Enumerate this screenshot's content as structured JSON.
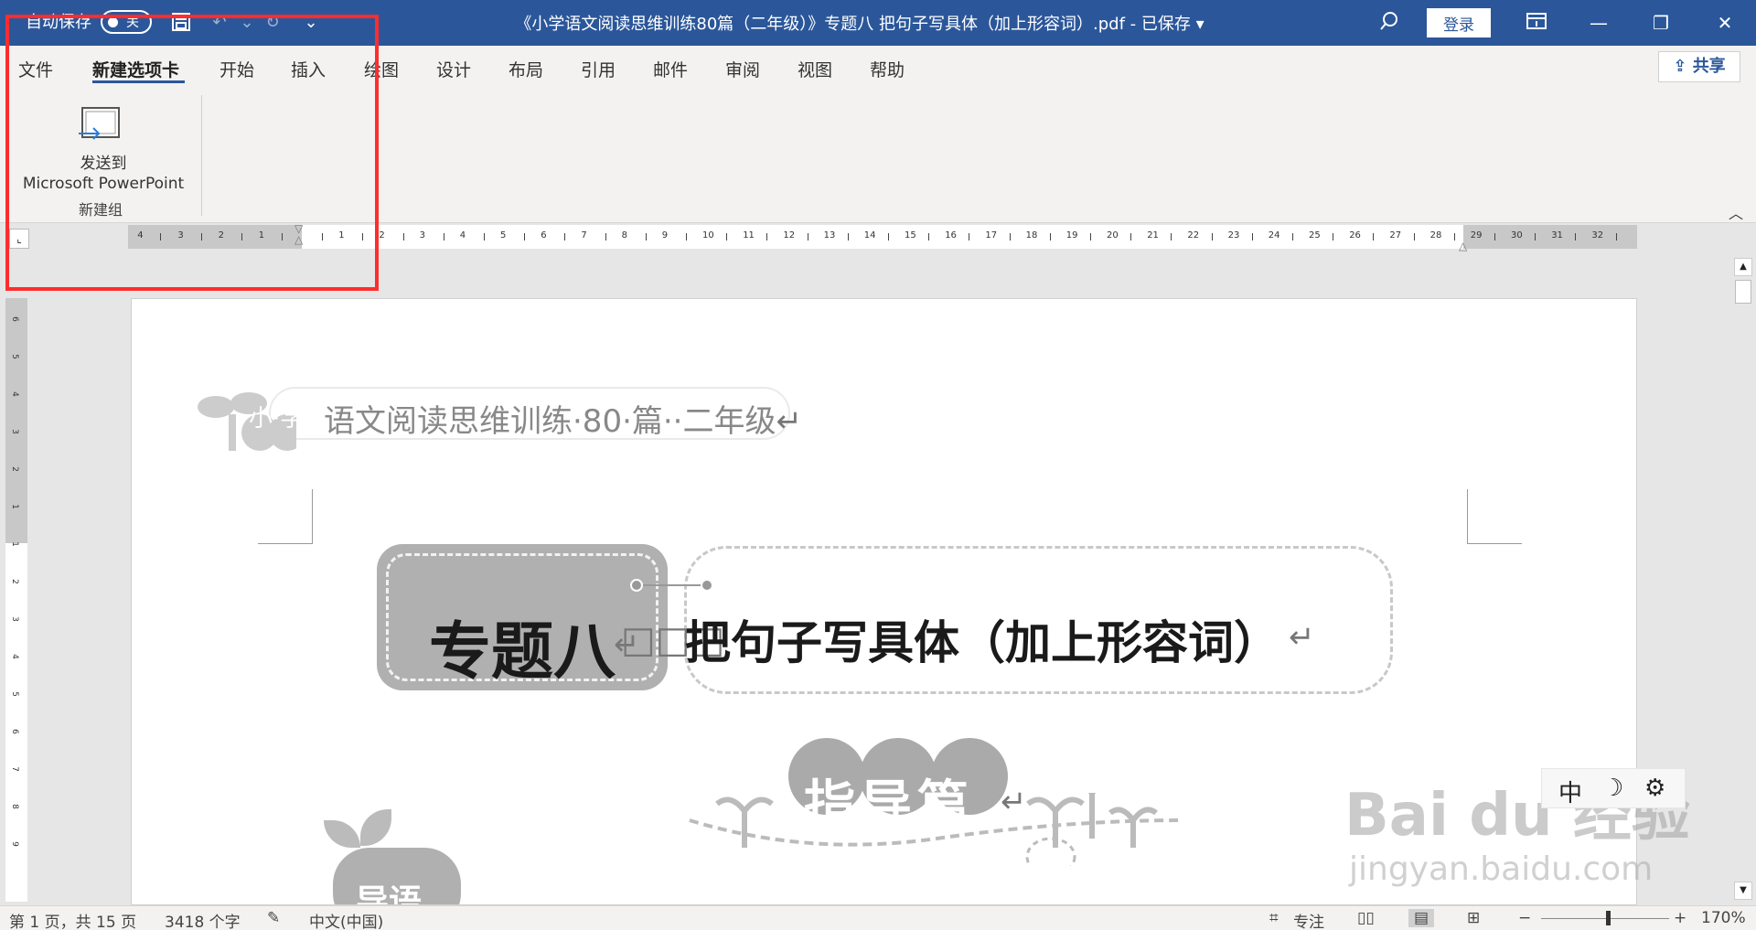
{
  "titlebar": {
    "autosave_label": "自动保存",
    "toggle_state": "关",
    "doc_title": "《小学语文阅读思维训练80篇（二年级）》专题八 把句子写具体（加上形容词）.pdf - 已保存",
    "login_label": "登录"
  },
  "tabs": [
    {
      "label": "文件"
    },
    {
      "label": "新建选项卡"
    },
    {
      "label": "开始"
    },
    {
      "label": "插入"
    },
    {
      "label": "绘图"
    },
    {
      "label": "设计"
    },
    {
      "label": "布局"
    },
    {
      "label": "引用"
    },
    {
      "label": "邮件"
    },
    {
      "label": "审阅"
    },
    {
      "label": "视图"
    },
    {
      "label": "帮助"
    }
  ],
  "share_label": "共享",
  "ribbon": {
    "send_label_line1": "发送到",
    "send_label_line2": "Microsoft PowerPoint",
    "group_label": "新建组"
  },
  "ruler": {
    "left_numbers": [
      "4",
      "3",
      "2",
      "1"
    ],
    "right_numbers": [
      "1",
      "2",
      "3",
      "4",
      "5",
      "6",
      "7",
      "8",
      "9",
      "10",
      "11",
      "12",
      "13",
      "14",
      "15",
      "16",
      "17",
      "18",
      "19",
      "20",
      "21",
      "22",
      "23",
      "24",
      "25",
      "26",
      "27",
      "28",
      "29",
      "30",
      "31",
      "32"
    ]
  },
  "vruler_numbers": [
    "6",
    "5",
    "4",
    "3",
    "2",
    "1",
    "1",
    "2",
    "3",
    "4",
    "5",
    "6",
    "7",
    "8",
    "9"
  ],
  "document": {
    "header_text": "语文阅读思维训练·80·篇··二年级",
    "header_prefix": "小·学",
    "topic_label": "专题八",
    "title_text": "把句子写具体（加上形容词）",
    "guide_text": "指导篇",
    "intro_text": "导语"
  },
  "ime": {
    "mode": "中"
  },
  "watermark": {
    "line1": "Bai du 经验",
    "line2": "jingyan.baidu.com"
  },
  "statusbar": {
    "page": "第 1 页，共 15 页",
    "words": "3418 个字",
    "language": "中文(中国)",
    "focus": "专注",
    "zoom": "170%"
  },
  "colors": {
    "brand": "#2b579a",
    "annotation": "#ff2d2d"
  }
}
